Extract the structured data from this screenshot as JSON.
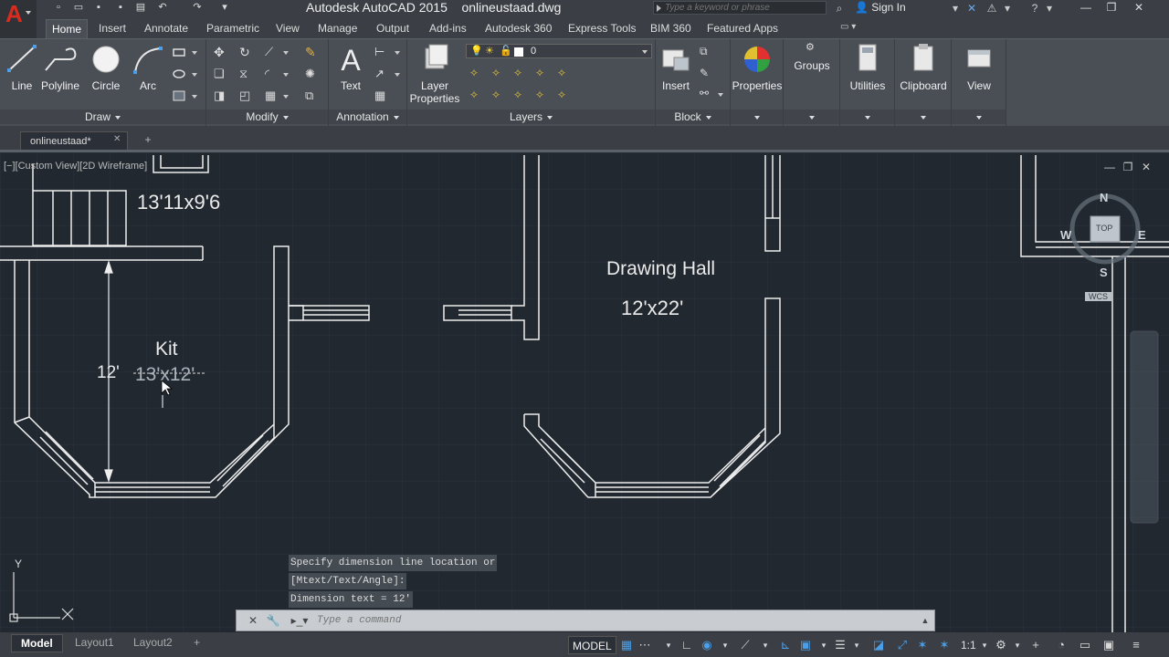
{
  "titlebar": {
    "app_title": "Autodesk AutoCAD 2015",
    "file_name": "onlineustaad.dwg",
    "search_placeholder": "Type a keyword or phrase",
    "sign_in": "Sign In"
  },
  "ribbon_tabs": [
    "Home",
    "Insert",
    "Annotate",
    "Parametric",
    "View",
    "Manage",
    "Output",
    "Add-ins",
    "Autodesk 360",
    "Express Tools",
    "BIM 360",
    "Featured Apps"
  ],
  "draw_panel": {
    "title": "Draw",
    "line": "Line",
    "polyline": "Polyline",
    "circle": "Circle",
    "arc": "Arc"
  },
  "modify_panel": {
    "title": "Modify"
  },
  "annotation_panel": {
    "title": "Annotation",
    "text": "Text"
  },
  "layers_panel": {
    "title": "Layers",
    "layer_properties_1": "Layer",
    "layer_properties_2": "Properties",
    "current_layer": "0"
  },
  "block_panel": {
    "title": "Block",
    "insert": "Insert"
  },
  "big_buttons": {
    "properties": "Properties",
    "groups": "Groups",
    "utilities": "Utilities",
    "clipboard": "Clipboard",
    "view": "View"
  },
  "file_tab": {
    "name": "onlineustaad*"
  },
  "viewport": {
    "label": "[−][Custom View][2D Wireframe]"
  },
  "drawing": {
    "room1_size": "13'11x9'6",
    "kitchen_name": "Kit",
    "kitchen_size": "13'x12'",
    "dimension_text": "12'",
    "hall_name": "Drawing Hall",
    "hall_size": "12'x22'"
  },
  "viewcube": {
    "n": "N",
    "s": "S",
    "e": "E",
    "w": "W",
    "top": "TOP",
    "wcs": "WCS"
  },
  "ucs": {
    "x": "X",
    "y": "Y"
  },
  "command_history": [
    "Specify dimension line location or",
    "[Mtext/Text/Angle]:",
    "Dimension text = 12'"
  ],
  "command_line": {
    "placeholder": "Type a command"
  },
  "layout_tabs": [
    "Model",
    "Layout1",
    "Layout2"
  ],
  "status": {
    "model": "MODEL",
    "scale": "1:1"
  },
  "colors": {
    "canvas": "#212830",
    "ribbon": "#4a4f56",
    "accent_red": "#d62d20",
    "status_blue": "#4a9fe8"
  }
}
